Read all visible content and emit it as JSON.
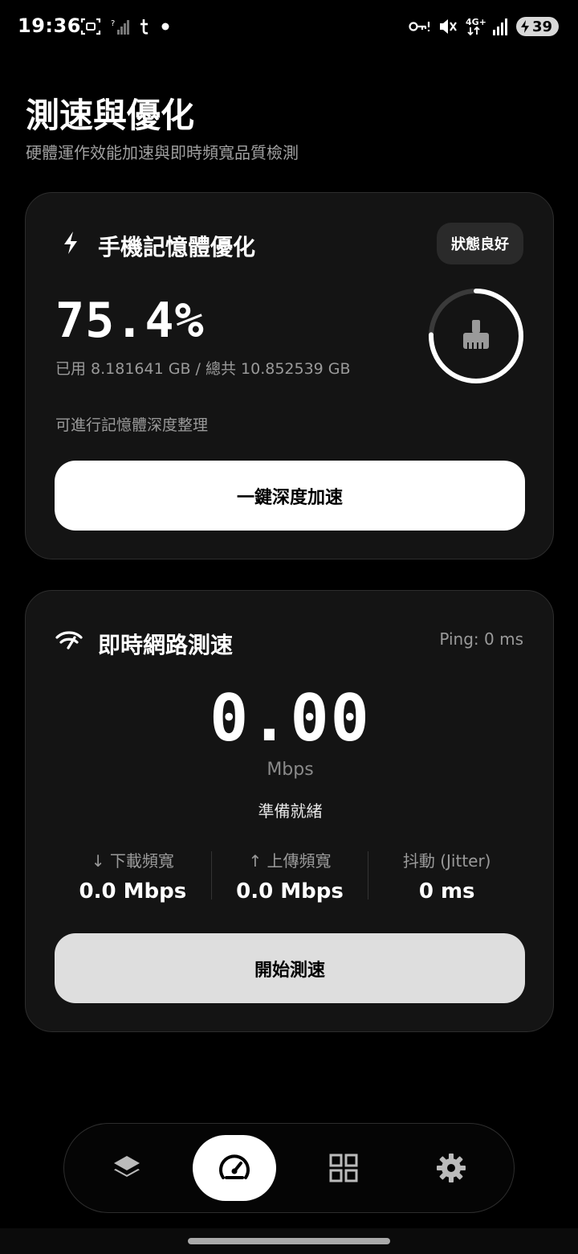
{
  "status_bar": {
    "time": "19:36",
    "left_icons": [
      "screenshot-icon",
      "no-signal-icon",
      "t-app-icon",
      "dot-icon"
    ],
    "right_icons": [
      "vpn-key-icon",
      "mute-icon",
      "4g-icon",
      "signal-icon"
    ],
    "network_label": "4G+",
    "battery": "39"
  },
  "header": {
    "title": "測速與優化",
    "subtitle": "硬體運作效能加速與即時頻寬品質檢測"
  },
  "memory_card": {
    "title": "手機記憶體優化",
    "icon": "lightning-icon",
    "status_chip": "狀態良好",
    "percent_text": "75.4%",
    "usage_fraction": 0.754,
    "usage_text": "已用 8.181641 GB / 總共 10.852539 GB",
    "note": "可進行記憶體深度整理",
    "ring_icon": "broom-icon",
    "button_label": "一鍵深度加速"
  },
  "network_card": {
    "title": "即時網路測速",
    "icon": "wifi-speed-icon",
    "ping": "Ping: 0 ms",
    "speed_value": "0.00",
    "speed_unit": "Mbps",
    "status": "準備就緒",
    "metrics": [
      {
        "label": "↓ 下載頻寬",
        "value": "0.0 Mbps"
      },
      {
        "label": "↑ 上傳頻寬",
        "value": "0.0 Mbps"
      },
      {
        "label": "抖動 (Jitter)",
        "value": "0 ms"
      }
    ],
    "button_label": "開始測速"
  },
  "bottom_nav": {
    "items": [
      {
        "icon": "layers-icon",
        "active": false
      },
      {
        "icon": "speedometer-icon",
        "active": true
      },
      {
        "icon": "grid-icon",
        "active": false
      },
      {
        "icon": "gear-icon",
        "active": false
      }
    ]
  },
  "colors": {
    "background": "#000000",
    "card": "#141414",
    "accent": "#ffffff",
    "muted_text": "#9a9a9a"
  }
}
